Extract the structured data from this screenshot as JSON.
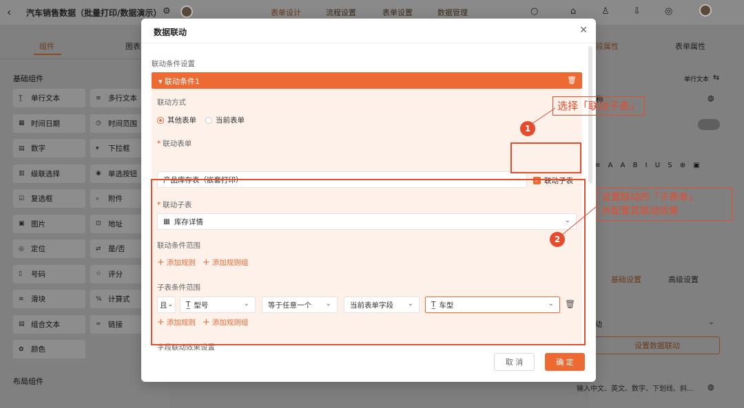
{
  "topbar": {
    "title": "汽车销售数据（批量打印/数据演示）",
    "nav": [
      "表单设计",
      "流程设置",
      "表单设置",
      "数据管理"
    ]
  },
  "left": {
    "tabs": [
      "组件",
      "图表"
    ],
    "section_basic": "基础组件",
    "section_layout": "布局组件",
    "components": [
      {
        "label": "单行文本",
        "icon": "T-icon"
      },
      {
        "label": "多行文本",
        "icon": "lines-icon"
      },
      {
        "label": "时间日期",
        "icon": "calendar-icon"
      },
      {
        "label": "时间范围",
        "icon": "clock-icon"
      },
      {
        "label": "数字",
        "icon": "number-icon"
      },
      {
        "label": "下拉框",
        "icon": "dropdown-icon"
      },
      {
        "label": "级联选择",
        "icon": "cascade-icon"
      },
      {
        "label": "单选按钮",
        "icon": "radio-icon"
      },
      {
        "label": "复选框",
        "icon": "checkbox-icon"
      },
      {
        "label": "附件",
        "icon": "paperclip-icon"
      },
      {
        "label": "图片",
        "icon": "image-icon"
      },
      {
        "label": "地址",
        "icon": "map-icon"
      },
      {
        "label": "定位",
        "icon": "location-icon"
      },
      {
        "label": "是/否",
        "icon": "toggle-icon"
      },
      {
        "label": "号码",
        "icon": "phone-icon"
      },
      {
        "label": "评分",
        "icon": "star-icon"
      },
      {
        "label": "滑块",
        "icon": "slider-icon"
      },
      {
        "label": "计算式",
        "icon": "percent-icon"
      },
      {
        "label": "组合文本",
        "icon": "doc-icon"
      },
      {
        "label": "链接",
        "icon": "link-icon"
      },
      {
        "label": "颜色",
        "icon": "palette-icon"
      }
    ]
  },
  "right": {
    "tabs": [
      "段属性",
      "表单属性"
    ],
    "single_text": "单行文本",
    "name_label": "称",
    "sub_tabs": [
      "基础设置",
      "高级设置"
    ],
    "linkage_label": "动",
    "set_linkage_button": "设置数据联动",
    "input_hint": "输入中文、英文、数字、下划线、斜..."
  },
  "modal": {
    "title": "数据联动",
    "section_title": "联动条件设置",
    "condition_bar": "联动条件1",
    "mode_label": "联动方式",
    "mode_options": [
      "其他表单",
      "当前表单"
    ],
    "form_label": "联动表单",
    "form_value": "产品库存表（嵌套打印）",
    "sub_checkbox": "联动子表",
    "subtable_label": "联动子表",
    "subtable_value": "库存详情",
    "cond_range_label": "联动条件范围",
    "add_rule": "添加规则",
    "add_rule_group": "添加规则组",
    "sub_cond_label": "子表条件范围",
    "cond_row": {
      "logic": "且",
      "field": "型号",
      "op": "等于任意一个",
      "source": "当前表单字段",
      "target": "车型"
    },
    "effect_label": "字段联动效果设置",
    "cancel": "取 消",
    "ok": "确 定"
  },
  "annotations": {
    "note1": "选择「联动子表」",
    "note2_line1": "设置联动的「子表单」",
    "note2_line2": "并配置其联动效果",
    "badge1": "1",
    "badge2": "2"
  },
  "colors": {
    "accent": "#ee6a33",
    "annotation": "#e64c2c"
  }
}
